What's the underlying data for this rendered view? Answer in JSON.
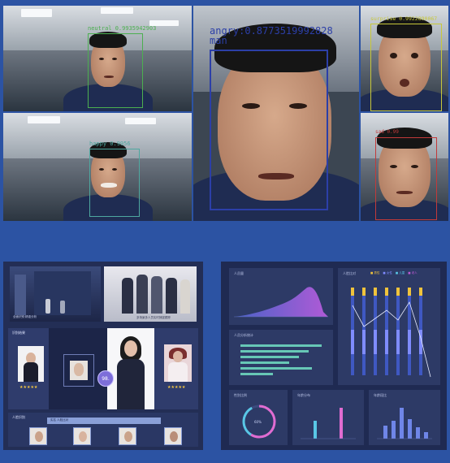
{
  "detections": [
    {
      "label": "neutral 0.9935942903",
      "tile": "top-left"
    },
    {
      "label": "happy 0.9956",
      "tile": "bottom-left"
    },
    {
      "label": "angry:0.8773519992828",
      "gender": "man",
      "tile": "center"
    },
    {
      "label": "surprise 0.9922890067",
      "tile": "top-right"
    },
    {
      "label": "sad 0.99",
      "tile": "bottom-right"
    }
  ],
  "colors": {
    "background": "#2c53a3",
    "neutral_box": "#4caf50",
    "happy_box": "#4ea8a0",
    "angry_box": "#2c3fa8",
    "surprise_box": "#c8c83a",
    "sad_box": "#c23a3a"
  },
  "left_dashboard": {
    "hero_captions": [
      "全面识别·精准分析",
      "多场景多人员实时捕捉跟踪"
    ],
    "section_title": "识别结果",
    "score_badge": "98.",
    "bottom_title": "人脸识别",
    "bottom_bar_text": "实名 人脸比对",
    "star_rows": [
      "★★★★★",
      "★★★★★"
    ]
  },
  "right_dashboard": {
    "panel_titles": [
      "人员量",
      "人员分析统计",
      "人脸比对",
      "性别比例",
      "年龄分布",
      "年龄段比"
    ],
    "legend": [
      "男性",
      "女性",
      "儿童",
      "老人"
    ],
    "donut_label": "60%",
    "icon_names": [
      "area-chart-icon",
      "bar-chart-icon",
      "donut-chart-icon"
    ]
  }
}
